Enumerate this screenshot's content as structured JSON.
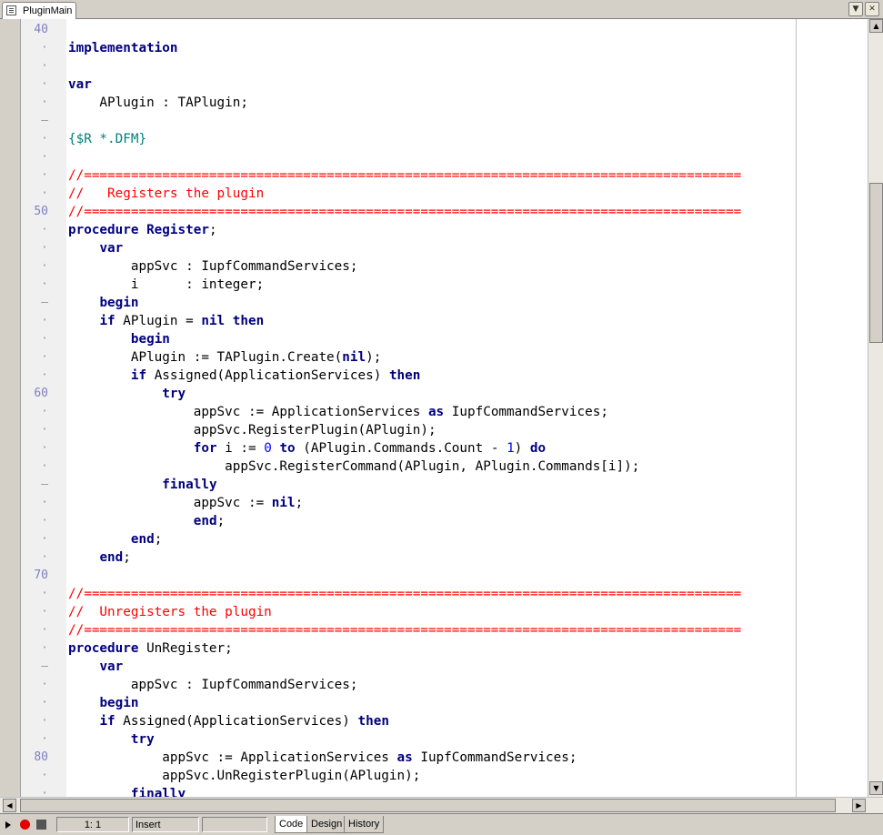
{
  "tab": {
    "title": "PluginMain"
  },
  "status": {
    "cursor": "1:  1",
    "mode": "Insert",
    "tabs": [
      "Code",
      "Design",
      "History"
    ]
  },
  "lines": [
    {
      "n": "40",
      "t": []
    },
    {
      "n": "·",
      "t": [
        [
          "kw",
          "implementation"
        ]
      ]
    },
    {
      "n": "·",
      "t": []
    },
    {
      "n": "·",
      "t": [
        [
          "kw",
          "var"
        ]
      ]
    },
    {
      "n": "·",
      "t": [
        [
          "",
          "    APlugin : TAPlugin;"
        ]
      ]
    },
    {
      "n": "–",
      "t": []
    },
    {
      "n": "·",
      "t": [
        [
          "dr",
          "{$R *.DFM}"
        ]
      ]
    },
    {
      "n": "·",
      "t": []
    },
    {
      "n": "·",
      "t": [
        [
          "cm",
          "//===================================================================================="
        ]
      ]
    },
    {
      "n": "·",
      "t": [
        [
          "cm",
          "//   Registers the plugin"
        ]
      ]
    },
    {
      "n": "50",
      "t": [
        [
          "cm",
          "//===================================================================================="
        ]
      ]
    },
    {
      "n": "·",
      "t": [
        [
          "kw",
          "procedure"
        ],
        [
          "",
          ""
        ],
        [
          "kw",
          " Register"
        ],
        [
          "",
          ";"
        ]
      ]
    },
    {
      "n": "·",
      "t": [
        [
          "",
          "    "
        ],
        [
          "kw",
          "var"
        ]
      ]
    },
    {
      "n": "·",
      "t": [
        [
          "",
          "        appSvc : IupfCommandServices;"
        ]
      ]
    },
    {
      "n": "·",
      "t": [
        [
          "",
          "        i      : integer;"
        ]
      ]
    },
    {
      "n": "–",
      "t": [
        [
          "",
          "    "
        ],
        [
          "kw",
          "begin"
        ]
      ]
    },
    {
      "n": "·",
      "t": [
        [
          "",
          "    "
        ],
        [
          "kw",
          "if"
        ],
        [
          "",
          " APlugin = "
        ],
        [
          "kw",
          "nil"
        ],
        [
          "",
          " "
        ],
        [
          "kw",
          "then"
        ]
      ]
    },
    {
      "n": "·",
      "t": [
        [
          "",
          "        "
        ],
        [
          "kw",
          "begin"
        ]
      ]
    },
    {
      "n": "·",
      "t": [
        [
          "",
          "        APlugin := TAPlugin.Create("
        ],
        [
          "kw",
          "nil"
        ],
        [
          "",
          ");"
        ]
      ]
    },
    {
      "n": "·",
      "t": [
        [
          "",
          "        "
        ],
        [
          "kw",
          "if"
        ],
        [
          "",
          " Assigned(ApplicationServices) "
        ],
        [
          "kw",
          "then"
        ]
      ]
    },
    {
      "n": "60",
      "t": [
        [
          "",
          "            "
        ],
        [
          "kw",
          "try"
        ]
      ]
    },
    {
      "n": "·",
      "t": [
        [
          "",
          "                appSvc := ApplicationServices "
        ],
        [
          "kw",
          "as"
        ],
        [
          "",
          " IupfCommandServices;"
        ]
      ]
    },
    {
      "n": "·",
      "t": [
        [
          "",
          "                appSvc.RegisterPlugin(APlugin);"
        ]
      ]
    },
    {
      "n": "·",
      "t": [
        [
          "",
          "                "
        ],
        [
          "kw",
          "for"
        ],
        [
          "",
          " i := "
        ],
        [
          "nm",
          "0"
        ],
        [
          "",
          " "
        ],
        [
          "kw",
          "to"
        ],
        [
          "",
          " (APlugin.Commands.Count - "
        ],
        [
          "nm",
          "1"
        ],
        [
          "",
          ") "
        ],
        [
          "kw",
          "do"
        ]
      ]
    },
    {
      "n": "·",
      "t": [
        [
          "",
          "                    appSvc.RegisterCommand(APlugin, APlugin.Commands[i]);"
        ]
      ]
    },
    {
      "n": "–",
      "t": [
        [
          "",
          "            "
        ],
        [
          "kw",
          "finally"
        ]
      ]
    },
    {
      "n": "·",
      "t": [
        [
          "",
          "                appSvc := "
        ],
        [
          "kw",
          "nil"
        ],
        [
          "",
          ";"
        ]
      ]
    },
    {
      "n": "·",
      "t": [
        [
          "",
          "                "
        ],
        [
          "kw",
          "end"
        ],
        [
          "",
          ";"
        ]
      ]
    },
    {
      "n": "·",
      "t": [
        [
          "",
          "        "
        ],
        [
          "kw",
          "end"
        ],
        [
          "",
          ";"
        ]
      ]
    },
    {
      "n": "·",
      "t": [
        [
          "",
          "    "
        ],
        [
          "kw",
          "end"
        ],
        [
          "",
          ";"
        ]
      ]
    },
    {
      "n": "70",
      "t": []
    },
    {
      "n": "·",
      "t": [
        [
          "cm",
          "//===================================================================================="
        ]
      ]
    },
    {
      "n": "·",
      "t": [
        [
          "cm",
          "//  Unregisters the plugin"
        ]
      ]
    },
    {
      "n": "·",
      "t": [
        [
          "cm",
          "//===================================================================================="
        ]
      ]
    },
    {
      "n": "·",
      "t": [
        [
          "kw",
          "procedure"
        ],
        [
          "",
          " UnRegister;"
        ]
      ]
    },
    {
      "n": "–",
      "t": [
        [
          "",
          "    "
        ],
        [
          "kw",
          "var"
        ]
      ]
    },
    {
      "n": "·",
      "t": [
        [
          "",
          "        appSvc : IupfCommandServices;"
        ]
      ]
    },
    {
      "n": "·",
      "t": [
        [
          "",
          "    "
        ],
        [
          "kw",
          "begin"
        ]
      ]
    },
    {
      "n": "·",
      "t": [
        [
          "",
          "    "
        ],
        [
          "kw",
          "if"
        ],
        [
          "",
          " Assigned(ApplicationServices) "
        ],
        [
          "kw",
          "then"
        ]
      ]
    },
    {
      "n": "·",
      "t": [
        [
          "",
          "        "
        ],
        [
          "kw",
          "try"
        ]
      ]
    },
    {
      "n": "80",
      "t": [
        [
          "",
          "            appSvc := ApplicationServices "
        ],
        [
          "kw",
          "as"
        ],
        [
          "",
          " IupfCommandServices;"
        ]
      ]
    },
    {
      "n": "·",
      "t": [
        [
          "",
          "            appSvc.UnRegisterPlugin(APlugin);"
        ]
      ]
    },
    {
      "n": "·",
      "t": [
        [
          "",
          "        "
        ],
        [
          "kw",
          "finally"
        ]
      ]
    }
  ]
}
